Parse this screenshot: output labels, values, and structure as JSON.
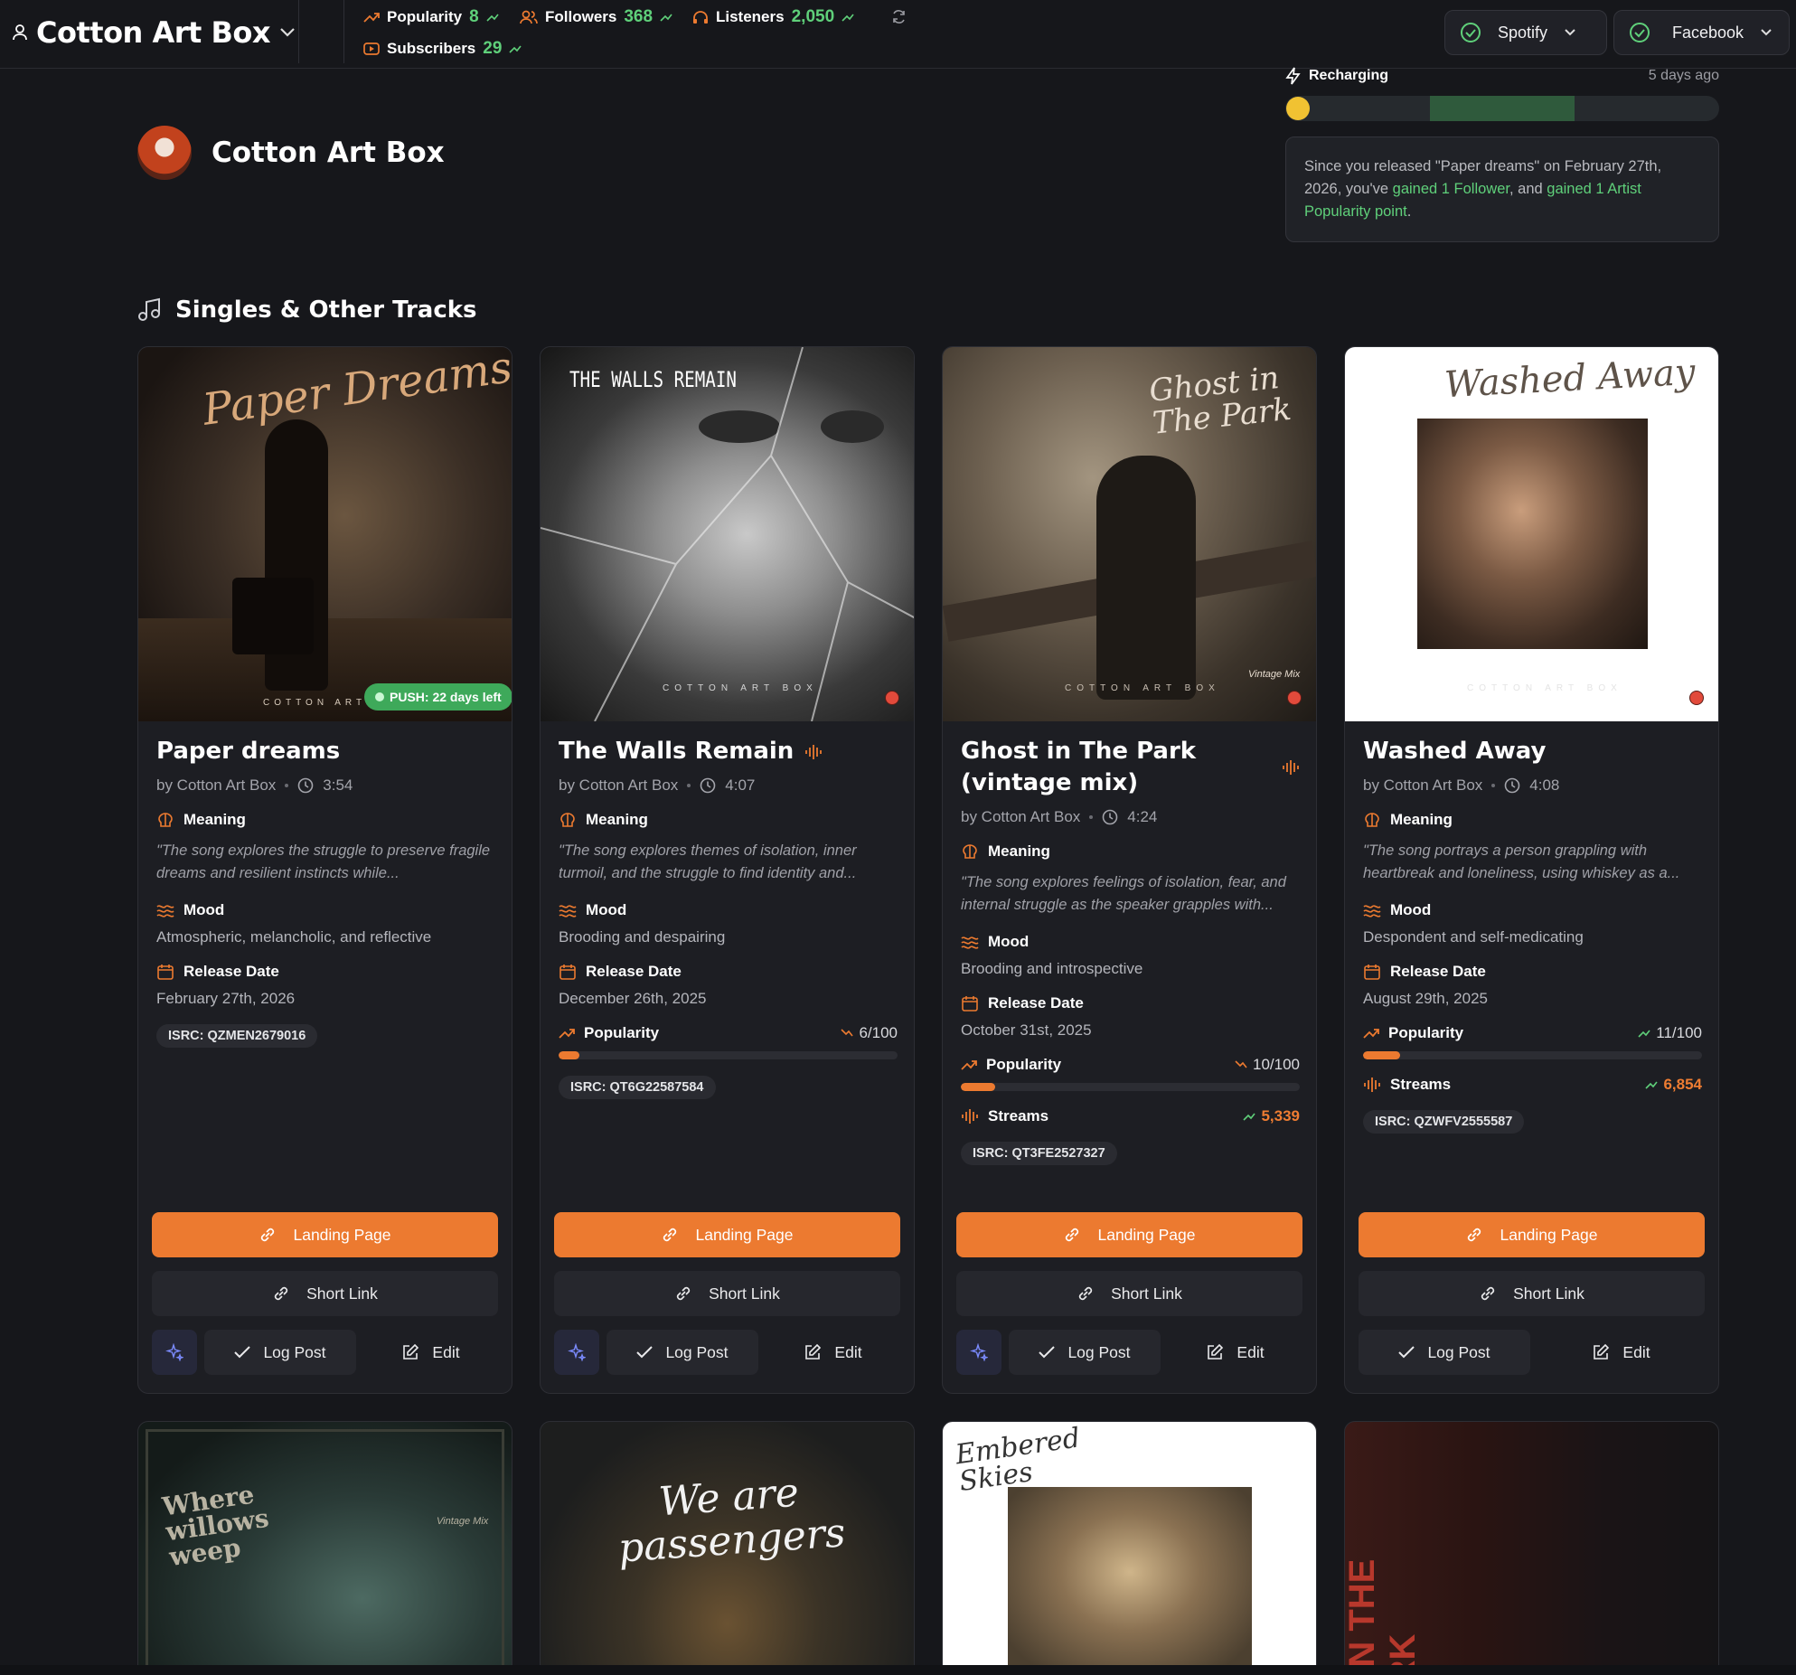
{
  "header": {
    "artist": "Cotton Art Box",
    "stats": [
      {
        "label": "Popularity",
        "value": "8"
      },
      {
        "label": "Followers",
        "value": "368"
      },
      {
        "label": "Listeners",
        "value": "2,050"
      },
      {
        "label": "Subscribers",
        "value": "29"
      }
    ],
    "platforms": [
      {
        "label": "Spotify"
      },
      {
        "label": "Facebook"
      }
    ]
  },
  "recharge": {
    "label": "Recharging",
    "ago": "5 days ago",
    "note": {
      "p1": "Since you released \"Paper dreams\" on February 27th, 2026, you've ",
      "g1": "gained 1 Follower",
      "p2": ", and ",
      "g2": "gained 1 Artist Popularity point",
      "p3": "."
    }
  },
  "artist_name": "Cotton Art Box",
  "section_title": "Singles & Other Tracks",
  "labels": {
    "meaning": "Meaning",
    "mood": "Mood",
    "release": "Release Date",
    "popularity": "Popularity",
    "streams": "Streams",
    "landing": "Landing Page",
    "short": "Short Link",
    "log": "Log Post",
    "edit": "Edit"
  },
  "tracks": [
    {
      "title": "Paper dreams",
      "by": "by Cotton Art Box",
      "duration": "3:54",
      "meaning": "\"The song explores the struggle to preserve fragile dreams and resilient instincts while...",
      "mood": "Atmospheric, melancholic, and reflective",
      "release": "February 27th, 2026",
      "isrc": "ISRC: QZMEN2679016",
      "push": "PUSH: 22 days left",
      "cover_text": "Paper Dreams",
      "cover_footer": "COTTON ART"
    },
    {
      "title": "The Walls Remain",
      "by": "by Cotton Art Box",
      "duration": "4:07",
      "meaning": "\"The song explores themes of isolation, inner turmoil, and the struggle to find identity and...",
      "mood": "Brooding and despairing",
      "release": "December 26th, 2025",
      "popularity": "6/100",
      "popularity_value": 6,
      "isrc": "ISRC: QT6G22587584",
      "cover_text": "THE WALLS REMAIN",
      "cover_footer": "COTTON ART BOX"
    },
    {
      "title": "Ghost in The Park (vintage mix)",
      "by": "by Cotton Art Box",
      "duration": "4:24",
      "meaning": "\"The song explores feelings of isolation, fear, and internal struggle as the speaker grapples with...",
      "mood": "Brooding and introspective",
      "release": "October 31st, 2025",
      "popularity": "10/100",
      "popularity_value": 10,
      "streams": "5,339",
      "isrc": "ISRC: QT3FE2527327",
      "cover_text": "Ghost in The Park",
      "cover_footer": "COTTON ART BOX",
      "cover_tag": "Vintage Mix"
    },
    {
      "title": "Washed Away",
      "by": "by Cotton Art Box",
      "duration": "4:08",
      "meaning": "\"The song portrays a person grappling with heartbreak and loneliness, using whiskey as a...",
      "mood": "Despondent and self-medicating",
      "release": "August 29th, 2025",
      "popularity": "11/100",
      "popularity_value": 11,
      "streams": "6,854",
      "isrc": "ISRC: QZWFV2555587",
      "cover_text": "Washed Away",
      "cover_footer": "COTTON ART BOX"
    }
  ],
  "more_covers": [
    {
      "text": "Where willows weep",
      "tag": "Vintage Mix"
    },
    {
      "text": "We are passengers"
    },
    {
      "text": "Embered Skies"
    },
    {
      "text": "ST IN THE PARK"
    }
  ],
  "colors": {
    "accent": "#ec7a30",
    "positive": "#5fd07a",
    "alert": "#e24a3b"
  }
}
